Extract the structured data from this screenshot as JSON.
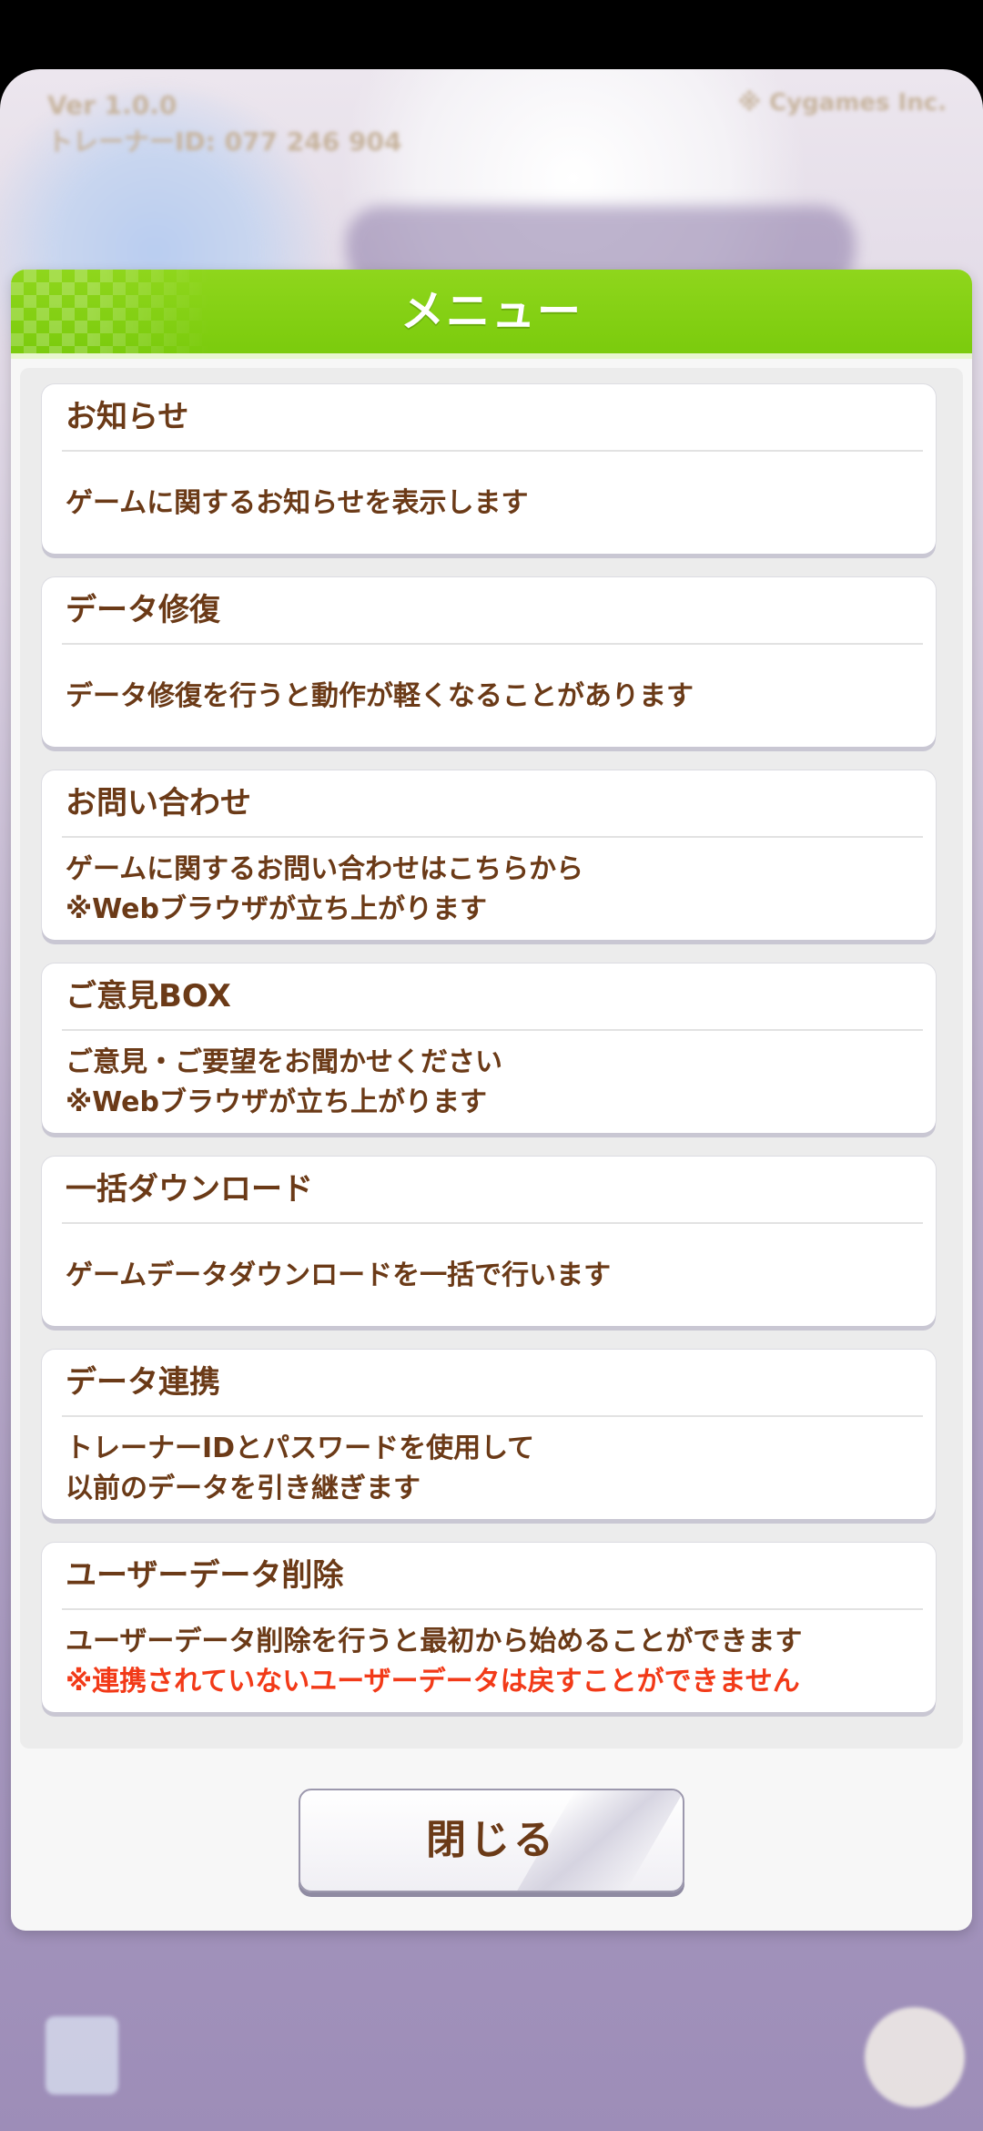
{
  "background": {
    "version_line1": "Ver 1.0.0",
    "version_line2": "トレーナーID: 077 246 904",
    "top_right_text": "※ Cygames Inc."
  },
  "dialog": {
    "title": "メニュー",
    "items": [
      {
        "title": "お知らせ",
        "desc": [
          "ゲームに関するお知らせを表示します"
        ]
      },
      {
        "title": "データ修復",
        "desc": [
          "データ修復を行うと動作が軽くなることがあります"
        ]
      },
      {
        "title": "お問い合わせ",
        "desc": [
          "ゲームに関するお問い合わせはこちらから",
          "※Webブラウザが立ち上がります"
        ]
      },
      {
        "title": "ご意見BOX",
        "desc": [
          "ご意見・ご要望をお聞かせください",
          "※Webブラウザが立ち上がります"
        ]
      },
      {
        "title": "一括ダウンロード",
        "desc": [
          "ゲームデータダウンロードを一括で行います"
        ]
      },
      {
        "title": "データ連携",
        "desc": [
          "トレーナーIDとパスワードを使用して",
          "以前のデータを引き継ぎます"
        ]
      },
      {
        "title": "ユーザーデータ削除",
        "desc": [
          "ユーザーデータ削除を行うと最初から始めることができます"
        ],
        "warning": "※連携されていないユーザーデータは戻すことができません"
      }
    ],
    "close_label": "閉じる"
  },
  "colors": {
    "header_green": "#7bcb0d",
    "text_brown": "#6b3a17",
    "warning_red": "#f23a18"
  }
}
